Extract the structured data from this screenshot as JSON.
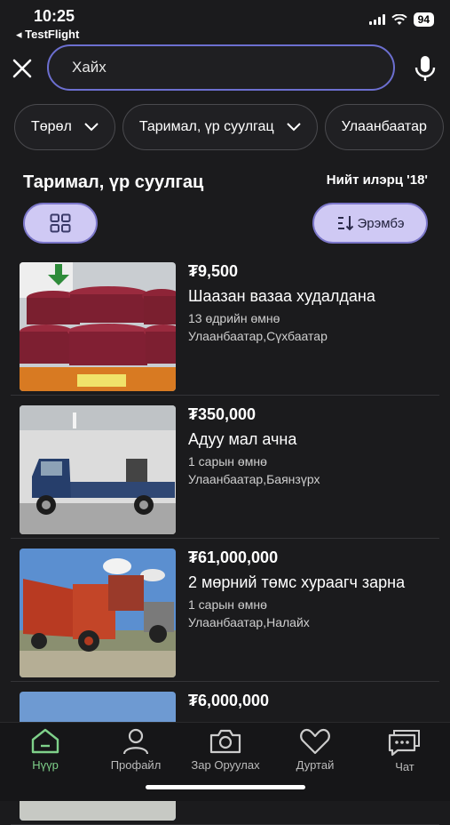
{
  "status_bar": {
    "time": "10:25",
    "back_app": "◂ TestFlight",
    "battery": "94"
  },
  "search": {
    "placeholder": "Хайх"
  },
  "filters": [
    "Төрөл",
    "Таримал, үр суулгац",
    "Улаанбаатар"
  ],
  "category_title": "Таримал, үр суулгац",
  "result_count": "Нийт илэрц '18'",
  "sort_label": "Эрэмбэ",
  "listings": [
    {
      "price": "₮9,500",
      "title": "Шаазан вазаа худалдана",
      "time": "13 өдрийн өмнө",
      "location": "Улаанбаатар,Сүхбаатар"
    },
    {
      "price": "₮350,000",
      "title": "Адуу мал ачна",
      "time": "1 сарын өмнө",
      "location": "Улаанбаатар,Баянзүрх"
    },
    {
      "price": "₮61,000,000",
      "title": "2 мөрний төмс хураагч зарна",
      "time": "1 сарын өмнө",
      "location": "Улаанбаатар,Налайх"
    },
    {
      "price": "₮6,000,000"
    }
  ],
  "nav": {
    "home": "Нүүр",
    "profile": "Профайл",
    "post_ad": "Зар Оруулах",
    "favorites": "Дуртай",
    "chat": "Чат"
  },
  "colors": {
    "accent": "#cfc9f4",
    "active_nav": "#7fd18a",
    "background": "#1b1b1d"
  }
}
